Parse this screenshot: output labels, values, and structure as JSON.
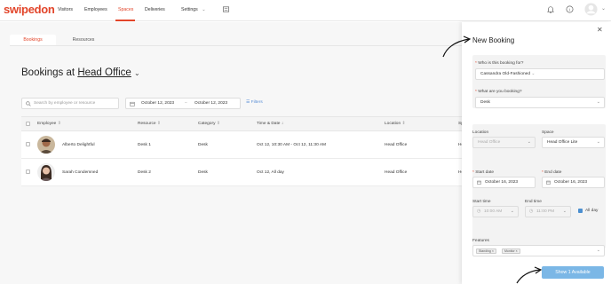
{
  "app": {
    "logo": "swipedon"
  },
  "nav": {
    "items": [
      {
        "label": "Visitors"
      },
      {
        "label": "Employees"
      },
      {
        "label": "Spaces"
      },
      {
        "label": "Deliveries"
      },
      {
        "label": "Settings"
      }
    ],
    "active": "Spaces"
  },
  "tabs": [
    {
      "label": "Bookings"
    },
    {
      "label": "Resources"
    }
  ],
  "page": {
    "title_prefix": "Bookings at",
    "location": "Head Office"
  },
  "search": {
    "placeholder": "Search by employee or resource"
  },
  "date_range": {
    "start": "October 12, 2023",
    "separator": "–",
    "end": "October 12, 2023"
  },
  "filters_label": "Filters",
  "table": {
    "headers": [
      "Employee",
      "Resource",
      "Category",
      "Time & Date",
      "Location",
      "Sp"
    ],
    "rows": [
      {
        "employee": "Alberto Delightful",
        "resource": "Desk 1",
        "category": "Desk",
        "time": "Oct 12, 10:30 AM - Oct 12, 11:30 AM",
        "location": "Head Office",
        "space": "He"
      },
      {
        "employee": "Sarah Condemned",
        "resource": "Desk 2",
        "category": "Desk",
        "time": "Oct 12, All day",
        "location": "Head Office",
        "space": "He"
      }
    ]
  },
  "panel": {
    "title": "New Booking",
    "who_label": "Who is this booking for?",
    "who_value": "Cassandra Old-Fashioned",
    "what_label": "What are you booking?",
    "what_value": "Desk",
    "location_label": "Location",
    "location_value": "Head Office",
    "space_label": "Space",
    "space_value": "Head Office Lite",
    "start_date_label": "Start date",
    "start_date_value": "October 16, 2023",
    "end_date_label": "End date",
    "end_date_value": "October 16, 2023",
    "start_time_label": "Start time",
    "start_time_value": "10:00 AM",
    "end_time_label": "End time",
    "end_time_value": "11:00 PM",
    "allday_label": "All day",
    "features_label": "Features",
    "features": [
      "Standing",
      "Monitor"
    ],
    "show_button": "Show 1 Available"
  },
  "colors": {
    "brand": "#e2452a",
    "link": "#5a8fd6",
    "button": "#7bb7e6"
  }
}
